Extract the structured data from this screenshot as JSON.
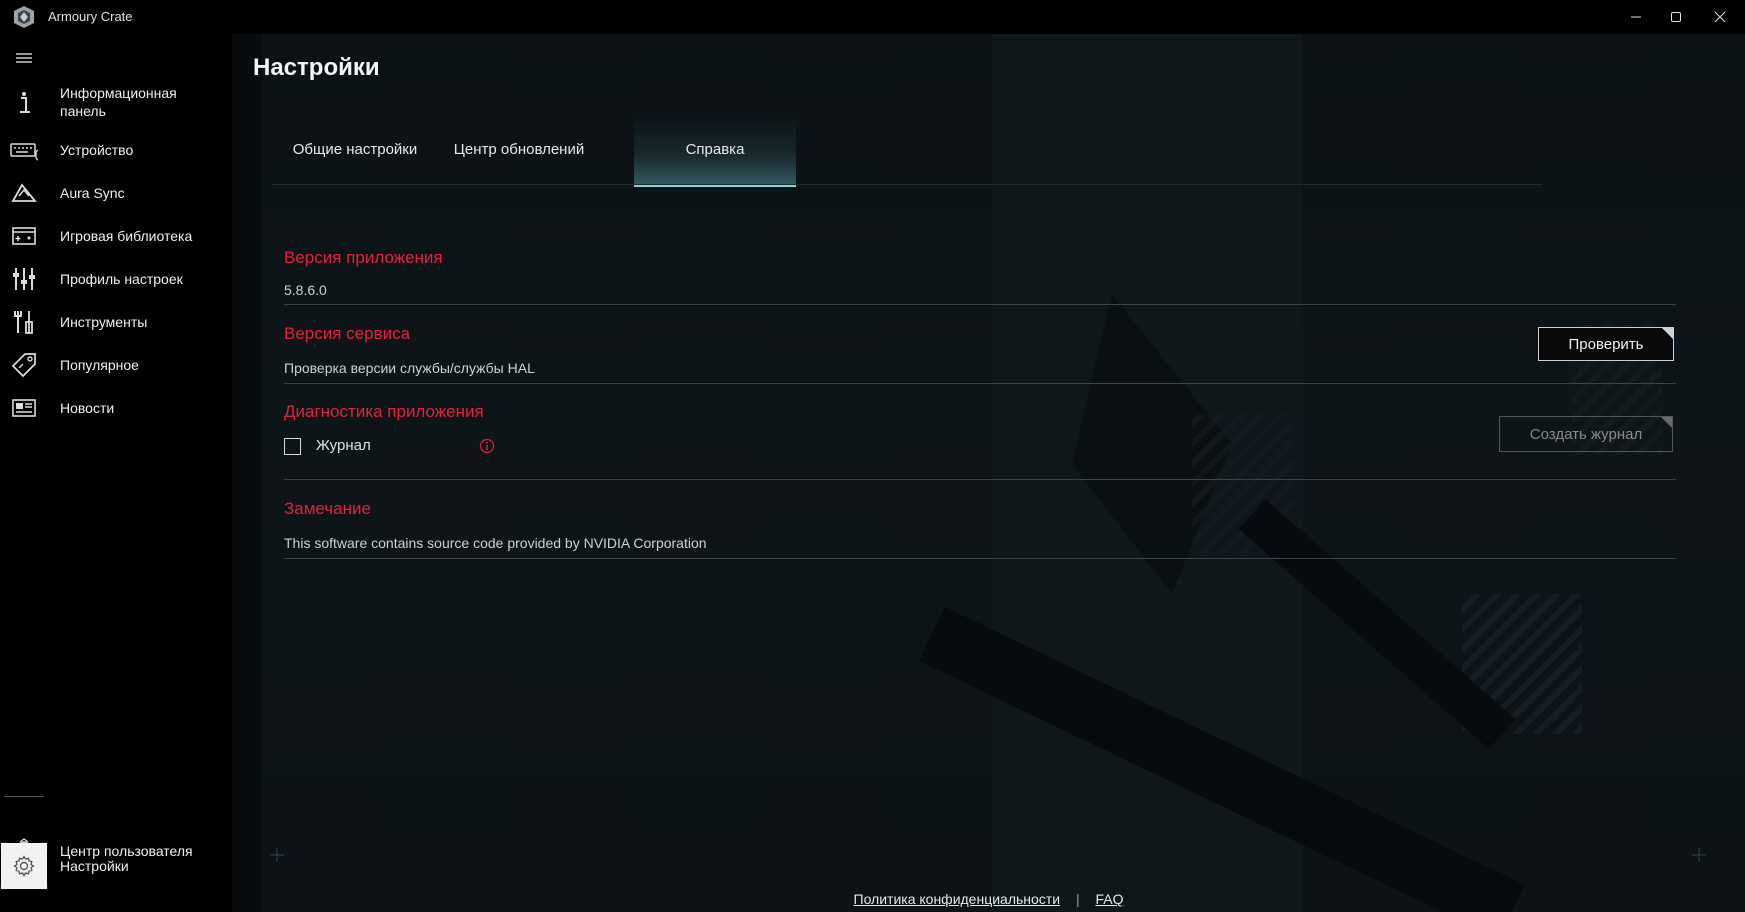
{
  "window": {
    "title": "Armoury Crate",
    "controls": [
      "minimize-icon",
      "maximize-icon",
      "close-icon"
    ]
  },
  "sidebar": {
    "menu_icon": "hamburger-icon",
    "items": [
      {
        "label": "Информационная панель",
        "icon": "info-icon"
      },
      {
        "label": "Устройство",
        "icon": "keyboard-icon"
      },
      {
        "label": "Aura Sync",
        "icon": "aura-icon"
      },
      {
        "label": "Игровая библиотека",
        "icon": "gamepad-library-icon"
      },
      {
        "label": "Профиль настроек",
        "icon": "sliders-icon"
      },
      {
        "label": "Инструменты",
        "icon": "tools-icon"
      },
      {
        "label": "Популярное",
        "icon": "tag-icon"
      },
      {
        "label": "Новости",
        "icon": "news-icon"
      }
    ],
    "bottom_items": [
      {
        "label": "Центр пользователя",
        "icon": "user-icon"
      },
      {
        "label": "Настройки",
        "icon": "gear-icon"
      }
    ]
  },
  "page": {
    "title": "Настройки",
    "tabs": [
      {
        "label": "Общие настройки",
        "active": false
      },
      {
        "label": "Центр обновлений",
        "active": false
      },
      {
        "label": "Справка",
        "active": true
      }
    ]
  },
  "sections": {
    "app_version": {
      "title": "Версия приложения",
      "value": "5.8.6.0"
    },
    "service_version": {
      "title": "Версия сервиса",
      "text": "Проверка версии службы/службы HAL",
      "button": "Проверить"
    },
    "diagnostics": {
      "title": "Диагностика приложения",
      "checkbox_label": "Журнал",
      "checked": false,
      "button": "Создать журнал"
    },
    "note": {
      "title": "Замечание",
      "text": "This software contains source code provided by NVIDIA Corporation"
    }
  },
  "footer": {
    "privacy": "Политика конфиденциальности",
    "separator": "|",
    "faq": "FAQ"
  },
  "colors": {
    "accent_red": "#e3223c",
    "tab_active_underline": "#8fd3dc",
    "background": "#000000"
  }
}
